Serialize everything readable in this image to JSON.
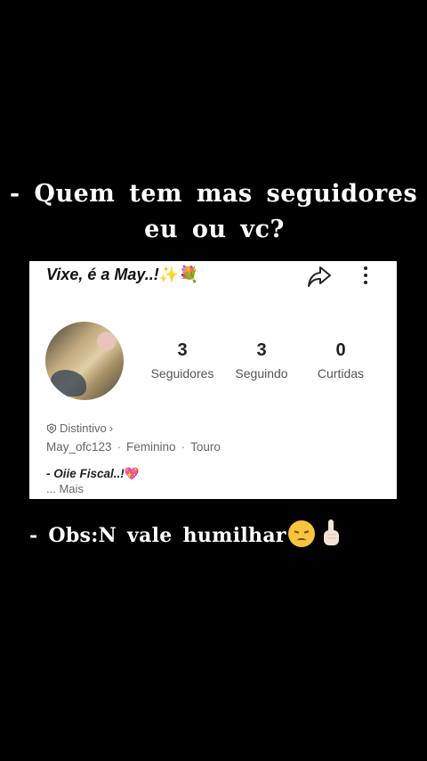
{
  "headline": {
    "line1": "- Quem tem mas seguidores",
    "line2": "eu ou vc?"
  },
  "profile": {
    "title": "Vixe, é a May..!",
    "title_emoji": [
      "sparkles-emoji",
      "bouquet-emoji"
    ],
    "stats": [
      {
        "value": "3",
        "label": "Seguidores"
      },
      {
        "value": "3",
        "label": "Seguindo"
      },
      {
        "value": "0",
        "label": "Curtidas"
      }
    ],
    "badge": "Distintivo",
    "username": "May_ofc123",
    "gender": "Feminino",
    "sign": "Touro",
    "bio": "- Oiie Fiscal..!",
    "more": "...  Mais"
  },
  "note": {
    "text": "- Obs:N vale humilhar"
  },
  "colors": {
    "background": "#000000",
    "card": "#ffffff",
    "text_light": "#ffffff",
    "heart": "#e8486f"
  }
}
